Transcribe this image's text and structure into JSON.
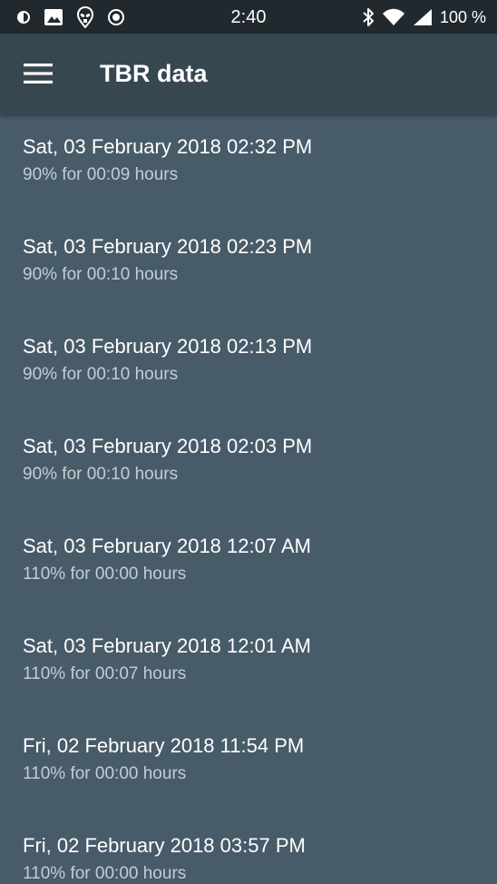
{
  "status_bar": {
    "time": "2:40",
    "battery": "100 %",
    "left_icons": [
      "data-saver-icon",
      "image-icon",
      "alien-icon",
      "record-icon"
    ],
    "right_icons": [
      "bluetooth-icon",
      "wifi-icon",
      "signal-icon"
    ]
  },
  "app_bar": {
    "menu_icon": "hamburger-menu-icon",
    "title": "TBR data"
  },
  "items": [
    {
      "title": "Sat, 03 February 2018 02:32 PM",
      "subtitle": "90% for 00:09 hours"
    },
    {
      "title": "Sat, 03 February 2018 02:23 PM",
      "subtitle": "90% for 00:10 hours"
    },
    {
      "title": "Sat, 03 February 2018 02:13 PM",
      "subtitle": "90% for 00:10 hours"
    },
    {
      "title": "Sat, 03 February 2018 02:03 PM",
      "subtitle": "90% for 00:10 hours"
    },
    {
      "title": "Sat, 03 February 2018 12:07 AM",
      "subtitle": "110% for 00:00 hours"
    },
    {
      "title": "Sat, 03 February 2018 12:01 AM",
      "subtitle": "110% for 00:07 hours"
    },
    {
      "title": "Fri, 02 February 2018 11:54 PM",
      "subtitle": "110% for 00:00 hours"
    },
    {
      "title": "Fri, 02 February 2018 03:57 PM",
      "subtitle": "110% for 00:00 hours"
    }
  ],
  "colors": {
    "background": "#485b68",
    "app_bar": "#37474f",
    "status_bar": "#22292e",
    "primary_text": "#ffffff",
    "secondary_text": "#c4ced4"
  }
}
